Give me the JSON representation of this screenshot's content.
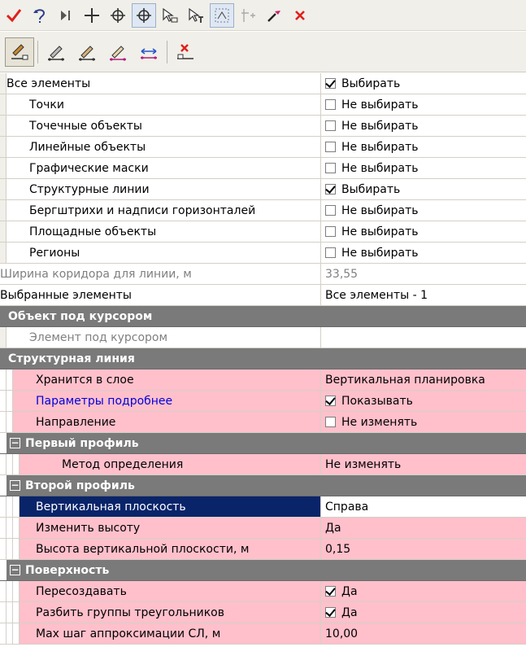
{
  "toolbar1": {
    "buttons": [
      {
        "name": "apply-icon"
      },
      {
        "name": "undo-icon"
      },
      {
        "name": "step-icon"
      },
      {
        "name": "add-point-icon"
      },
      {
        "name": "target-icon"
      },
      {
        "name": "move-target-icon"
      },
      {
        "name": "select-contour-icon"
      },
      {
        "name": "select-text-icon"
      },
      {
        "name": "select-region-icon"
      },
      {
        "name": "snap-points-icon"
      },
      {
        "name": "pipette-icon"
      },
      {
        "name": "cancel-icon"
      }
    ]
  },
  "toolbar2": {
    "buttons": [
      {
        "name": "edit-object-icon"
      },
      {
        "name": "pencil-icon"
      },
      {
        "name": "eraser-pencil-icon"
      },
      {
        "name": "draw-line-icon"
      },
      {
        "name": "distance-icon"
      },
      {
        "name": "delete-object-icon"
      }
    ]
  },
  "grid": {
    "all_elements": {
      "label": "Все элементы",
      "value": "Выбирать",
      "checked": true
    },
    "filters": [
      {
        "label": "Точки",
        "value": "Не выбирать",
        "checked": false
      },
      {
        "label": "Точечные объекты",
        "value": "Не выбирать",
        "checked": false
      },
      {
        "label": "Линейные объекты",
        "value": "Не выбирать",
        "checked": false
      },
      {
        "label": "Графические маски",
        "value": "Не выбирать",
        "checked": false
      },
      {
        "label": "Структурные линии",
        "value": "Выбирать",
        "checked": true
      },
      {
        "label": "Бергштрихи и надписи горизонталей",
        "value": "Не выбирать",
        "checked": false
      },
      {
        "label": "Площадные объекты",
        "value": "Не выбирать",
        "checked": false
      },
      {
        "label": "Регионы",
        "value": "Не выбирать",
        "checked": false
      }
    ],
    "corridor": {
      "label": "Ширина коридора для линии, м",
      "value": "33,55"
    },
    "selected": {
      "label": "Выбранные элементы",
      "value": "Все элементы - 1"
    },
    "cursor_section": {
      "title": "Объект под курсором",
      "item_label": "Элемент под курсором",
      "item_value": ""
    },
    "sl_section": {
      "title": "Структурная линия",
      "layer": {
        "label": "Хранится в слое",
        "value": "Вертикальная планировка"
      },
      "params": {
        "label": "Параметры подробнее",
        "value": "Показывать",
        "checked": true
      },
      "direction": {
        "label": "Направление",
        "value": "Не изменять",
        "checked": false
      }
    },
    "profile1": {
      "title": "Первый профиль",
      "method": {
        "label": "Метод определения",
        "value": "Не изменять"
      }
    },
    "profile2": {
      "title": "Второй профиль",
      "plane": {
        "label": "Вертикальная плоскость",
        "value": "Справа"
      },
      "change_height": {
        "label": "Изменить высоту",
        "value": "Да"
      },
      "plane_height": {
        "label": "Высота вертикальной плоскости, м",
        "value": "0,15"
      }
    },
    "surface": {
      "title": "Поверхность",
      "recreate": {
        "label": "Пересоздавать",
        "value": "Да",
        "checked": true
      },
      "split": {
        "label": "Разбить группы треугольников",
        "value": "Да",
        "checked": true
      },
      "max_step": {
        "label": "Max шаг аппроксимации СЛ, м",
        "value": "10,00"
      }
    }
  }
}
